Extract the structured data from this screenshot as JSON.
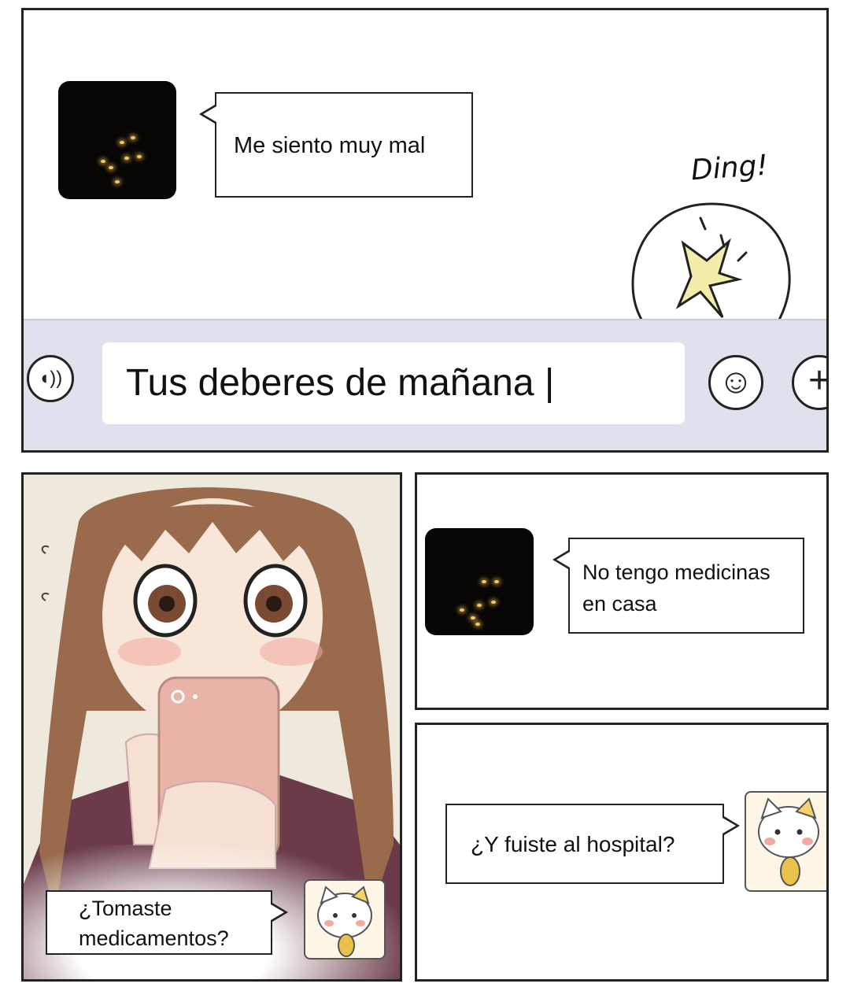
{
  "panel1": {
    "message": "Me siento muy mal",
    "ding_label": "Ding!",
    "input_text": "Tus deberes de mañana |",
    "voice_icon": "voice-icon",
    "emoji_icon": "smiley-icon",
    "plus_icon": "plus-icon"
  },
  "panel2": {
    "message_line1": "¿Tomaste",
    "message_line2": "medicamentos?"
  },
  "panel3": {
    "message_line1": "No tengo medicinas",
    "message_line2": "en casa"
  },
  "panel4": {
    "message": "¿Y fuiste al hospital?"
  },
  "colors": {
    "input_bar": "#dfe2ec",
    "ding_burst": "#f3ecaa",
    "phone": "#e9b4a8",
    "hair": "#9a6a4c"
  }
}
